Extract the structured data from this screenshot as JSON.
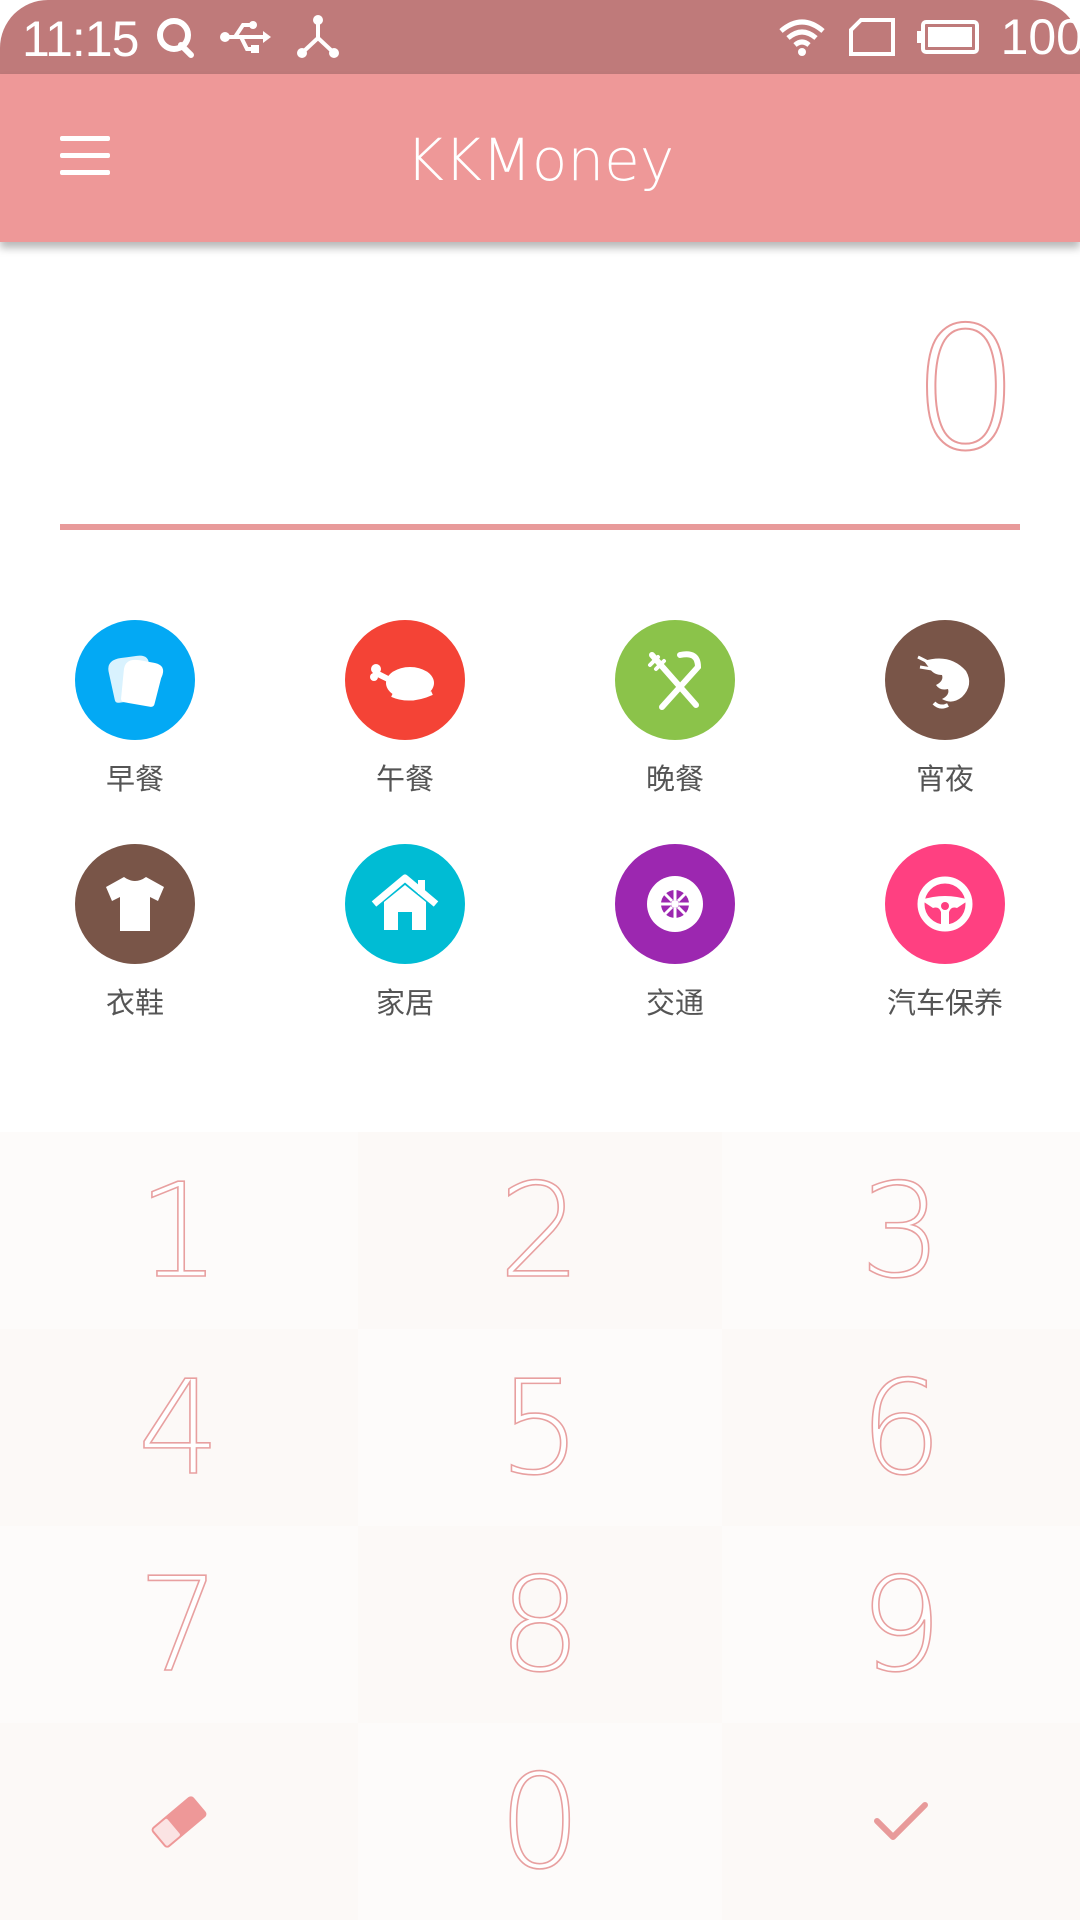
{
  "status_bar": {
    "time": "11:15",
    "battery": "100",
    "icons": [
      "q-notification-icon",
      "usb-icon",
      "share-icon",
      "wifi-icon",
      "sim-card-icon",
      "battery-icon"
    ]
  },
  "app_bar": {
    "title": "KKMoney",
    "menu_icon": "hamburger-menu-icon"
  },
  "amount": {
    "value": "0"
  },
  "categories": [
    {
      "label": "早餐",
      "icon": "bread-icon",
      "color": "#03a9f4"
    },
    {
      "label": "午餐",
      "icon": "roast-chicken-icon",
      "color": "#f44336"
    },
    {
      "label": "晚餐",
      "icon": "fork-knife-icon",
      "color": "#8bc34a"
    },
    {
      "label": "宵夜",
      "icon": "shrimp-icon",
      "color": "#795548"
    },
    {
      "label": "衣鞋",
      "icon": "tshirt-icon",
      "color": "#795548"
    },
    {
      "label": "家居",
      "icon": "house-icon",
      "color": "#00bcd4"
    },
    {
      "label": "交通",
      "icon": "wheel-icon",
      "color": "#9c27b0"
    },
    {
      "label": "汽车保养",
      "icon": "steering-wheel-icon",
      "color": "#ff4081"
    }
  ],
  "keypad": {
    "keys": [
      "1",
      "2",
      "3",
      "4",
      "5",
      "6",
      "7",
      "8",
      "9",
      "",
      "0",
      ""
    ],
    "eraser_icon": "eraser-icon",
    "confirm_icon": "checkmark-icon"
  },
  "colors": {
    "status_bar": "#bf7a7a",
    "app_bar": "#ee9898",
    "accent": "#e89a9a"
  }
}
